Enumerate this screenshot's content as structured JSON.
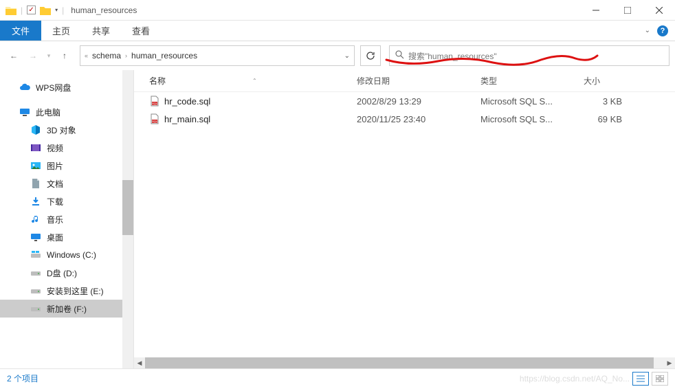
{
  "window": {
    "title": "human_resources"
  },
  "ribbon": {
    "file": "文件",
    "home": "主页",
    "share": "共享",
    "view": "查看"
  },
  "breadcrumb": {
    "items": [
      "schema",
      "human_resources"
    ]
  },
  "search": {
    "placeholder": "搜索\"human_resources\""
  },
  "columns": {
    "name": "名称",
    "date": "修改日期",
    "type": "类型",
    "size": "大小"
  },
  "nav": {
    "wps": "WPS网盘",
    "thispc": "此电脑",
    "items": [
      {
        "label": "3D 对象",
        "icon": "3d"
      },
      {
        "label": "视频",
        "icon": "video"
      },
      {
        "label": "图片",
        "icon": "pictures"
      },
      {
        "label": "文档",
        "icon": "documents"
      },
      {
        "label": "下载",
        "icon": "downloads"
      },
      {
        "label": "音乐",
        "icon": "music"
      },
      {
        "label": "桌面",
        "icon": "desktop"
      },
      {
        "label": "Windows (C:)",
        "icon": "drive-win"
      },
      {
        "label": "D盘 (D:)",
        "icon": "drive"
      },
      {
        "label": "安装到这里 (E:)",
        "icon": "drive"
      },
      {
        "label": "新加卷 (F:)",
        "icon": "drive",
        "selected": true
      }
    ]
  },
  "files": [
    {
      "name": "hr_code.sql",
      "date": "2002/8/29 13:29",
      "type": "Microsoft SQL S...",
      "size": "3 KB"
    },
    {
      "name": "hr_main.sql",
      "date": "2020/11/25 23:40",
      "type": "Microsoft SQL S...",
      "size": "69 KB"
    }
  ],
  "status": {
    "count": "2 个项目",
    "watermark": "https://blog.csdn.net/AQ_No..."
  }
}
